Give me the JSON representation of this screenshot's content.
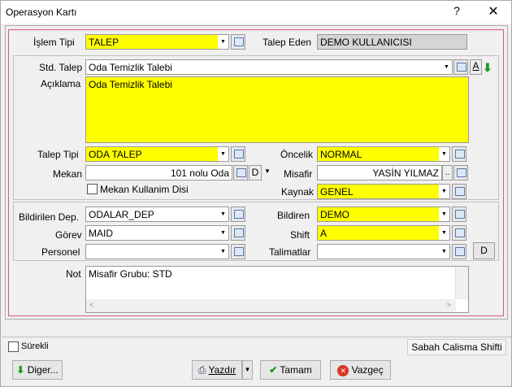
{
  "window": {
    "title": "Operasyon Kartı",
    "help": "?",
    "close": "✕"
  },
  "form": {
    "islem_tipi_label": "İşlem Tipi",
    "islem_tipi": "TALEP",
    "talep_eden_label": "Talep Eden",
    "talep_eden": "DEMO KULLANICISI",
    "std_talep_label": "Std. Talep",
    "std_talep": "Oda Temizlik Talebi",
    "aciklama_label": "Açıklama",
    "aciklama": "Oda Temizlik Talebi",
    "talep_tipi_label": "Talep Tipi",
    "talep_tipi": "ODA TALEP",
    "oncelik_label": "Öncelik",
    "oncelik": "NORMAL",
    "mekan_label": "Mekan",
    "mekan": "101 nolu Oda",
    "mekan_d": "D",
    "misafir_label": "Misafir",
    "misafir": "YASİN YILMAZ",
    "mekan_kullanim_label": "Mekan Kullanim Disi",
    "kaynak_label": "Kaynak",
    "kaynak": "GENEL",
    "bildirilen_dep_label": "Bildirilen Dep.",
    "bildirilen_dep": "ODALAR_DEP",
    "bildiren_label": "Bildiren",
    "bildiren": "DEMO",
    "gorev_label": "Görev",
    "gorev": "MAID",
    "shift_label": "Shift",
    "shift": "A",
    "personel_label": "Personel",
    "personel": "",
    "talimatlar_label": "Talimatlar",
    "talimatlar": "",
    "talimat_d": "D",
    "not_label": "Not",
    "not": "Misafir Grubu: STD",
    "ellipsis": "..",
    "font_a": "A"
  },
  "status": {
    "surekli_label": "Sürekli",
    "shift_text": "Sabah Calisma Shifti"
  },
  "buttons": {
    "diger": "Diger...",
    "yazdir": "Yazdır",
    "tamam": "Tamam",
    "vazgec": "Vazgeç"
  }
}
